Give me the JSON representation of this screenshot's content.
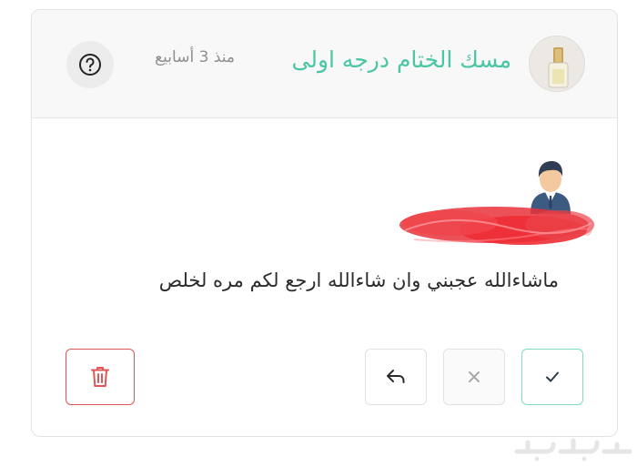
{
  "review": {
    "product_title": "مسك الختام درجه اولى",
    "time_ago": "منذ 3 أسابيع",
    "comment": "ماشاءالله عجبني وان شاءالله ارجع لكم مره لخلص"
  },
  "actions": {
    "approve_icon": "check-icon",
    "reject_icon": "x-icon",
    "reply_icon": "reply-arrow-icon",
    "delete_icon": "trash-icon",
    "help_icon": "question-circle-icon"
  },
  "colors": {
    "accent": "#49c6a3",
    "danger": "#e05656",
    "header_bg": "#f8f8f8"
  }
}
